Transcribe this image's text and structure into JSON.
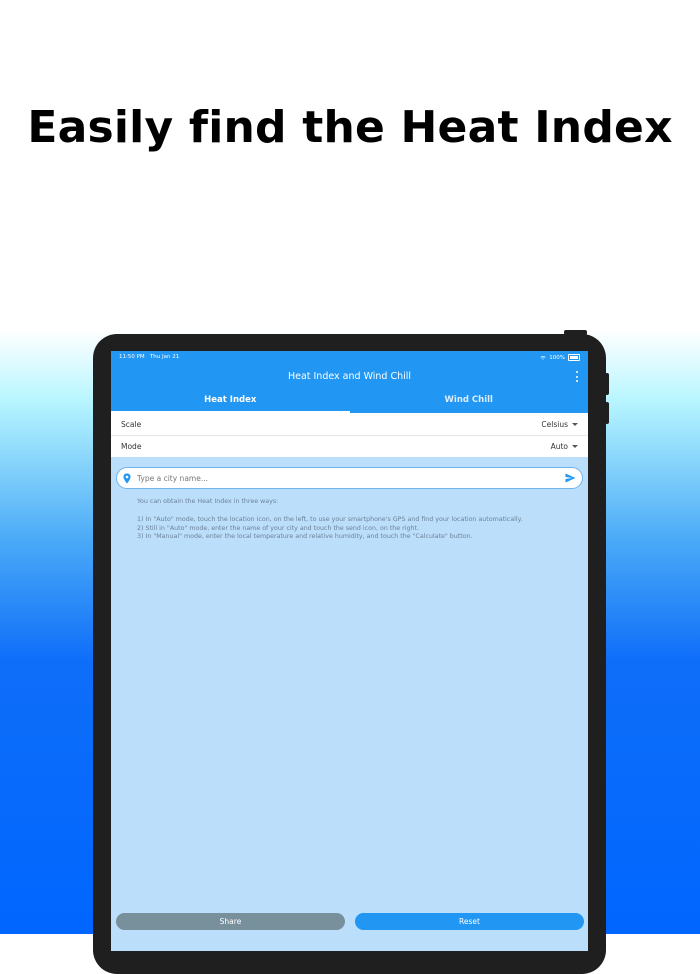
{
  "headline": "Easily find the Heat Index",
  "status_bar": {
    "time": "11:50 PM",
    "date": "Thu Jan 21",
    "battery": "100%"
  },
  "app": {
    "title": "Heat Index and Wind Chill",
    "tabs": [
      {
        "label": "Heat Index",
        "active": true
      },
      {
        "label": "Wind Chill",
        "active": false
      }
    ]
  },
  "settings": {
    "scale_label": "Scale",
    "scale_value": "Celsius",
    "mode_label": "Mode",
    "mode_value": "Auto"
  },
  "search": {
    "placeholder": "Type a city name...",
    "value": ""
  },
  "help": {
    "intro": "You can obtain the Heat Index in three ways:",
    "steps": [
      "1) In \"Auto\" mode, touch the location icon, on the left, to use your smartphone's GPS and find your location automatically.",
      "2) Still in \"Auto\" mode, enter the name of your city and touch the send icon, on the right.",
      "3) In \"Manual\" mode, enter the local temperature and relative humidity, and touch the \"Calculate\" button."
    ]
  },
  "buttons": {
    "share": "Share",
    "reset": "Reset"
  },
  "colors": {
    "primary": "#2196f3",
    "content_bg": "#bbdefb",
    "share_button": "#78909c",
    "device_frame": "#1f1f1f"
  },
  "icons": {
    "location": "location-pin-icon",
    "send": "send-icon",
    "menu": "more-vert-icon",
    "wifi": "wifi-icon",
    "battery": "battery-icon"
  }
}
